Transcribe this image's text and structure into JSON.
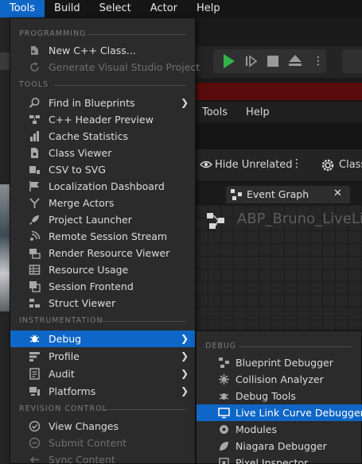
{
  "menubar": {
    "items": [
      "Tools",
      "Build",
      "Select",
      "Actor",
      "Help"
    ],
    "active": "Tools"
  },
  "background": {
    "bp_menubar_items": [
      "Tools",
      "Help"
    ],
    "hide_unrelated_label": "Hide Unrelated",
    "class_label": "Class",
    "graph_tab_label": "Event Graph",
    "graph_title": "ABP_Bruno_LiveLin"
  },
  "tools_menu": {
    "sections": {
      "programming": "PROGRAMMING",
      "tools": "TOOLS",
      "instrumentation": "INSTRUMENTATION",
      "revision_control": "REVISION CONTROL"
    },
    "programming_items": [
      {
        "label": "New C++ Class...",
        "icon": "cpp-class-icon",
        "disabled": false
      },
      {
        "label": "Generate Visual Studio Project",
        "icon": "refresh-icon",
        "disabled": true
      }
    ],
    "tools_items": [
      {
        "label": "Find in Blueprints",
        "icon": "search-icon",
        "submenu": true
      },
      {
        "label": "C++ Header Preview",
        "icon": "header-preview-icon"
      },
      {
        "label": "Cache Statistics",
        "icon": "statistics-icon"
      },
      {
        "label": "Class Viewer",
        "icon": "class-viewer-icon"
      },
      {
        "label": "CSV to SVG",
        "icon": "csv-icon"
      },
      {
        "label": "Localization Dashboard",
        "icon": "flag-icon"
      },
      {
        "label": "Merge Actors",
        "icon": "merge-icon"
      },
      {
        "label": "Project Launcher",
        "icon": "rocket-icon"
      },
      {
        "label": "Remote Session Stream",
        "icon": "stream-icon"
      },
      {
        "label": "Render Resource Viewer",
        "icon": "render-icon"
      },
      {
        "label": "Resource Usage",
        "icon": "table-icon"
      },
      {
        "label": "Session Frontend",
        "icon": "session-icon"
      },
      {
        "label": "Struct Viewer",
        "icon": "struct-icon"
      }
    ],
    "instrumentation_items": [
      {
        "label": "Debug",
        "icon": "bug-icon",
        "submenu": true,
        "selected": true
      },
      {
        "label": "Profile",
        "icon": "profile-icon",
        "submenu": true
      },
      {
        "label": "Audit",
        "icon": "audit-icon",
        "submenu": true
      },
      {
        "label": "Platforms",
        "icon": "platforms-icon",
        "submenu": true
      }
    ],
    "revision_items": [
      {
        "label": "View Changes",
        "icon": "check-circle-icon",
        "disabled": false
      },
      {
        "label": "Submit Content",
        "icon": "minus-circle-icon",
        "disabled": true
      },
      {
        "label": "Sync Content",
        "icon": "arrow-left-icon",
        "disabled": true
      }
    ]
  },
  "debug_submenu": {
    "section": "DEBUG",
    "items": [
      {
        "label": "Blueprint Debugger",
        "icon": "blueprint-debugger-icon"
      },
      {
        "label": "Collision Analyzer",
        "icon": "collision-icon"
      },
      {
        "label": "Debug Tools",
        "icon": "bug-icon"
      },
      {
        "label": "Live Link Curve Debugger",
        "icon": "monitor-icon",
        "selected": true
      },
      {
        "label": "Modules",
        "icon": "modules-icon"
      },
      {
        "label": "Niagara Debugger",
        "icon": "niagara-icon"
      },
      {
        "label": "Pixel Inspector",
        "icon": "pixel-inspector-icon"
      }
    ]
  },
  "colors": {
    "accent": "#0e66c6",
    "menu_bg": "#2b2b2b",
    "play_green": "#31b34a"
  }
}
